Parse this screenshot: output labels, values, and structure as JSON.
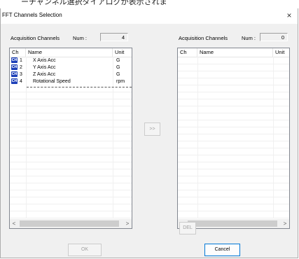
{
  "dialog": {
    "title": "FFT Channels Selection",
    "close_glyph": "×"
  },
  "background_caption": "ーチャンネル選択ダイアログが表示されま",
  "left_panel": {
    "label": "Acquisition Channels",
    "num_label": "Num :",
    "num_value": "4",
    "columns": [
      "Ch",
      "Name",
      "Unit"
    ],
    "rows": [
      {
        "ch": "1",
        "name": "X Axis Acc",
        "unit": "G"
      },
      {
        "ch": "2",
        "name": "Y Axis Acc",
        "unit": "G"
      },
      {
        "ch": "3",
        "name": "Z Axis Acc",
        "unit": "G"
      },
      {
        "ch": "4",
        "name": "Rotational Speed",
        "unit": "rpm"
      }
    ],
    "scroll_left": "<",
    "scroll_right": ">"
  },
  "right_panel": {
    "label": "Acquisition Channels",
    "num_label": "Num :",
    "num_value": "0",
    "columns": [
      "Ch",
      "Name",
      "Unit"
    ],
    "rows": [],
    "scroll_left": "<",
    "scroll_right": ">"
  },
  "buttons": {
    "transfer": ">>",
    "delete": "DEL",
    "ok": "OK",
    "cancel": "Cancel"
  },
  "icons": {
    "channel_icon": "channel-badge-icon",
    "channel_icon_glyph": "CH",
    "channel_icon_color": "#1c3fb8"
  }
}
